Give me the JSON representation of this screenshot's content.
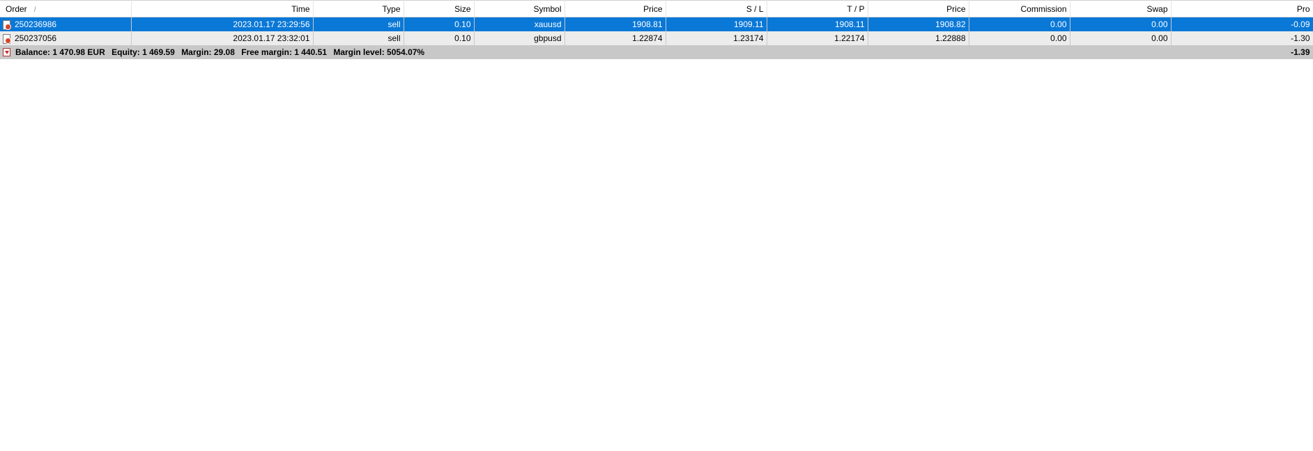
{
  "columns": {
    "order": "Order",
    "order_sort": "/",
    "time": "Time",
    "type": "Type",
    "size": "Size",
    "symbol": "Symbol",
    "price_open": "Price",
    "sl": "S / L",
    "tp": "T / P",
    "price_current": "Price",
    "commission": "Commission",
    "swap": "Swap",
    "profit": "Pro"
  },
  "orders": [
    {
      "order": "250236986",
      "time": "2023.01.17 23:29:56",
      "type": "sell",
      "size": "0.10",
      "symbol": "xauusd",
      "price_open": "1908.81",
      "sl": "1909.11",
      "tp": "1908.11",
      "price_current": "1908.82",
      "commission": "0.00",
      "swap": "0.00",
      "profit": "-0.09",
      "selected": true
    },
    {
      "order": "250237056",
      "time": "2023.01.17 23:32:01",
      "type": "sell",
      "size": "0.10",
      "symbol": "gbpusd",
      "price_open": "1.22874",
      "sl": "1.23174",
      "tp": "1.22174",
      "price_current": "1.22888",
      "commission": "0.00",
      "swap": "0.00",
      "profit": "-1.30",
      "selected": false
    }
  ],
  "summary": {
    "balance_label": "Balance:",
    "balance_value": "1 470.98 EUR",
    "equity_label": "Equity:",
    "equity_value": "1 469.59",
    "margin_label": "Margin:",
    "margin_value": "29.08",
    "free_margin_label": "Free margin:",
    "free_margin_value": "1 440.51",
    "margin_level_label": "Margin level:",
    "margin_level_value": "5054.07%",
    "total_profit": "-1.39"
  },
  "colors": {
    "selection": "#0a78d7",
    "row_background": "#ececec",
    "summary_background": "#c8c8c8",
    "order_icon_dot": "#d6452a"
  },
  "icons": {
    "order_row": "sell-order-document-icon",
    "summary_row": "balance-down-arrow-icon"
  }
}
